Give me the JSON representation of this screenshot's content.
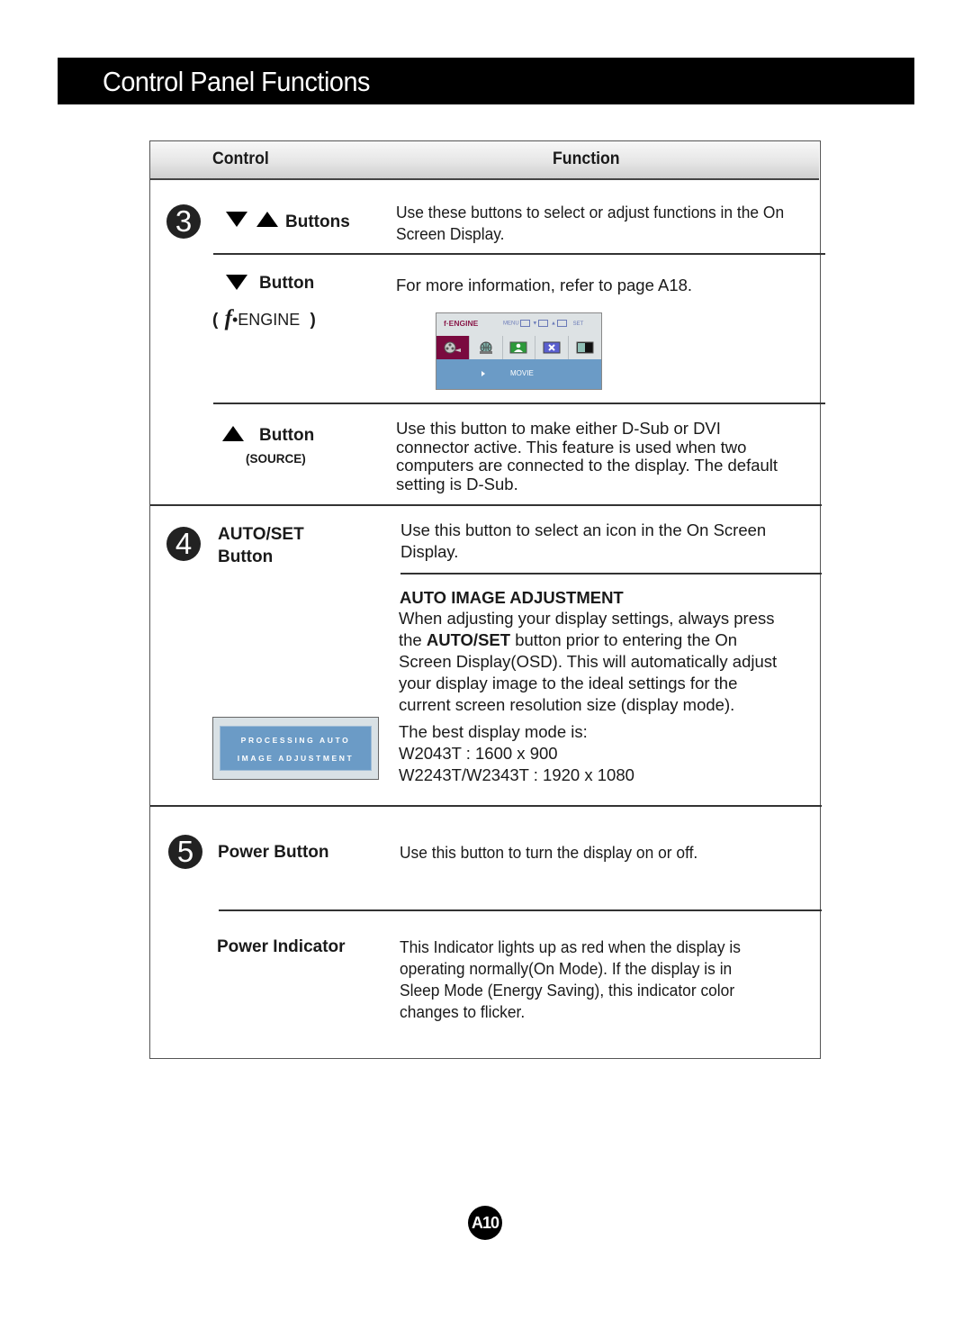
{
  "page_title": "Control Panel Functions",
  "table": {
    "headers": {
      "control": "Control",
      "function": "Function"
    },
    "sections": [
      {
        "number": "3",
        "rows": [
          {
            "control_label": "Buttons",
            "control_icons": [
              "down-triangle",
              "up-triangle"
            ],
            "description": [
              "Use these buttons to select or adjust functions in the On",
              "Screen Display."
            ]
          },
          {
            "control_label": "Button",
            "control_icons": [
              "down-triangle"
            ],
            "control_sub": {
              "open": "(",
              "f_glyph": "f",
              "text": "•ENGINE",
              "close": ")"
            },
            "description": [
              "For more information, refer to page A18."
            ],
            "osd_preview": {
              "brand": "f·ENGINE",
              "keys": [
                "MENU",
                "▼",
                "▲",
                "SET"
              ],
              "icons": [
                "movie-reel-icon",
                "internet-globe-icon",
                "picture-person-icon",
                "close-x-icon",
                "contrast-icon"
              ],
              "selected_index": 0,
              "row_label": "MOVIE",
              "colors": {
                "selected": "#7a0a3f",
                "row": "#6b9bc6"
              }
            }
          },
          {
            "control_label": "Button",
            "control_icons": [
              "up-triangle"
            ],
            "control_sub_text": "(SOURCE)",
            "description": [
              "Use this button to make either D-Sub or DVI",
              "connector active. This feature is used when two",
              "computers are connected to the display. The default",
              "setting is D-Sub."
            ]
          }
        ]
      },
      {
        "number": "4",
        "rows": [
          {
            "control_label": [
              "AUTO/SET",
              "Button"
            ],
            "description": [
              "Use this button to select an icon in the On Screen",
              "Display."
            ]
          },
          {
            "heading": "AUTO IMAGE ADJUSTMENT",
            "description_parts": {
              "line1": "When adjusting your display settings, always press",
              "line2_pre": "the ",
              "line2_bold": "AUTO/SET",
              "line2_post": " button prior to entering the On",
              "line3": "Screen Display(OSD). This will automatically adjust",
              "line4": "your display image to the ideal settings for the",
              "line5": "current screen resolution size (display mode)."
            },
            "best_mode": [
              "The best display mode is:",
              "W2043T : 1600 x 900",
              "W2243T/W2343T : 1920 x 1080"
            ],
            "processing_box": [
              "PROCESSING AUTO",
              "IMAGE ADJUSTMENT"
            ]
          }
        ]
      },
      {
        "number": "5",
        "rows": [
          {
            "control_label": "Power Button",
            "description": [
              "Use this button to turn the display on or off."
            ]
          },
          {
            "control_label": "Power Indicator",
            "description": [
              "This Indicator lights up as red when the display is",
              "operating normally(On Mode). If the display is in",
              "Sleep Mode (Energy Saving), this indicator color",
              "changes to flicker."
            ]
          }
        ]
      }
    ]
  },
  "page_number": "A10"
}
